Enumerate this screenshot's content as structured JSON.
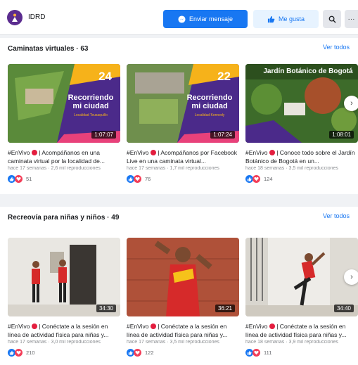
{
  "header": {
    "page_name": "IDRD",
    "message_button": "Enviar mensaje",
    "like_button": "Me gusta",
    "icons": [
      "avatar-logo",
      "messenger-icon",
      "thumbs-up-icon",
      "search-icon",
      "more-icon"
    ]
  },
  "sections": [
    {
      "title": "Caminatas virtuales · 63",
      "link": "Ver todos",
      "videos": [
        {
          "badge": "24",
          "thumb_title": "Recorriendo mi ciudad",
          "thumb_subtitle": "Localidad Teusaquillo",
          "duration": "1:07:07",
          "title": "#EnVivo 🔴 | Acompáñanos en una caminata virtual por la localidad de...",
          "meta": "hace 17 semanas · 2,6 mil reproducciones",
          "reactions": "51"
        },
        {
          "badge": "22",
          "thumb_title": "Recorriendo mi ciudad",
          "thumb_subtitle": "Localidad Kennedy",
          "duration": "1:07:24",
          "title": "#EnVivo 🔴 | Acompáñanos por Facebook Live en una caminata virtual...",
          "meta": "hace 17 semanas · 1,7 mil reproducciones",
          "reactions": "76"
        },
        {
          "badge": "",
          "thumb_title": "Jardín Botánico de Bogotá",
          "thumb_subtitle": "",
          "duration": "1:08:01",
          "title": "#EnVivo 🔴 | Conoce todo sobre el Jardín Botánico de Bogotá en un...",
          "meta": "hace 18 semanas · 3,5 mil reproducciones",
          "reactions": "124"
        }
      ]
    },
    {
      "title": "Recreovía para niñas y niños · 49",
      "link": "Ver todos",
      "videos": [
        {
          "duration": "34:30",
          "title": "#EnVivo 🔴 | Conéctate a la sesión en línea de actividad física para niñas y...",
          "meta": "hace 17 semanas · 3,0 mil reproducciones",
          "reactions": "210"
        },
        {
          "duration": "36:21",
          "title": "#EnVivo 🔴 | Conéctate a la sesión en línea de actividad física para niñas y...",
          "meta": "hace 17 semanas · 3,5 mil reproducciones",
          "reactions": "122"
        },
        {
          "duration": "34:40",
          "title": "#EnVivo 🔴 | Conéctate a la sesión en línea de actividad física para niñas y...",
          "meta": "hace 18 semanas · 3,9 mil reproducciones",
          "reactions": "111"
        }
      ]
    }
  ],
  "colors": {
    "accent": "#1877f2",
    "background": "#f0f2f5",
    "live": "#e41e3f",
    "brand_purple": "#4b2a8a"
  }
}
